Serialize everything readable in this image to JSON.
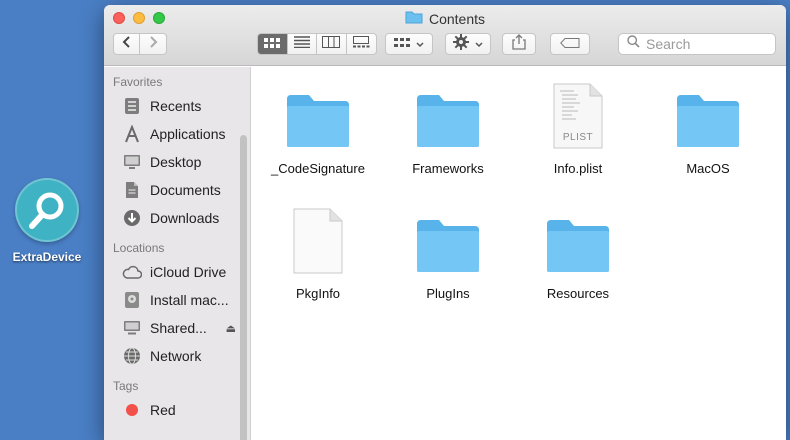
{
  "desktop": {
    "app_label": "ExtraDevice"
  },
  "window": {
    "title": "Contents"
  },
  "toolbar": {
    "back": "‹",
    "forward": "›",
    "view_modes": [
      "icon-view",
      "list-view",
      "column-view",
      "gallery-view"
    ],
    "active_view": 0
  },
  "search": {
    "placeholder": "Search"
  },
  "sidebar": {
    "favorites_heading": "Favorites",
    "favorites": [
      {
        "label": "Recents",
        "icon": "clock-icon"
      },
      {
        "label": "Applications",
        "icon": "applications-icon"
      },
      {
        "label": "Desktop",
        "icon": "desktop-icon"
      },
      {
        "label": "Documents",
        "icon": "document-icon"
      },
      {
        "label": "Downloads",
        "icon": "download-icon"
      }
    ],
    "locations_heading": "Locations",
    "locations": [
      {
        "label": "iCloud Drive",
        "icon": "cloud-icon"
      },
      {
        "label": "Install mac...",
        "icon": "disk-icon"
      },
      {
        "label": "Shared...",
        "icon": "display-icon",
        "eject": "⏏"
      },
      {
        "label": "Network",
        "icon": "globe-icon"
      }
    ],
    "tags_heading": "Tags",
    "tags": [
      {
        "label": "Red",
        "color": "#f2504b"
      }
    ]
  },
  "files": [
    {
      "name": "_CodeSignature",
      "kind": "folder"
    },
    {
      "name": "Frameworks",
      "kind": "folder"
    },
    {
      "name": "Info.plist",
      "kind": "plist",
      "badge": "PLIST"
    },
    {
      "name": "MacOS",
      "kind": "folder"
    },
    {
      "name": "PkgInfo",
      "kind": "document"
    },
    {
      "name": "PlugIns",
      "kind": "folder"
    },
    {
      "name": "Resources",
      "kind": "folder"
    }
  ],
  "colors": {
    "desktop": "#4a7fc6",
    "folder": "#6cc0f0",
    "sidebar": "#e8e6e8",
    "tag_red": "#f2504b"
  }
}
